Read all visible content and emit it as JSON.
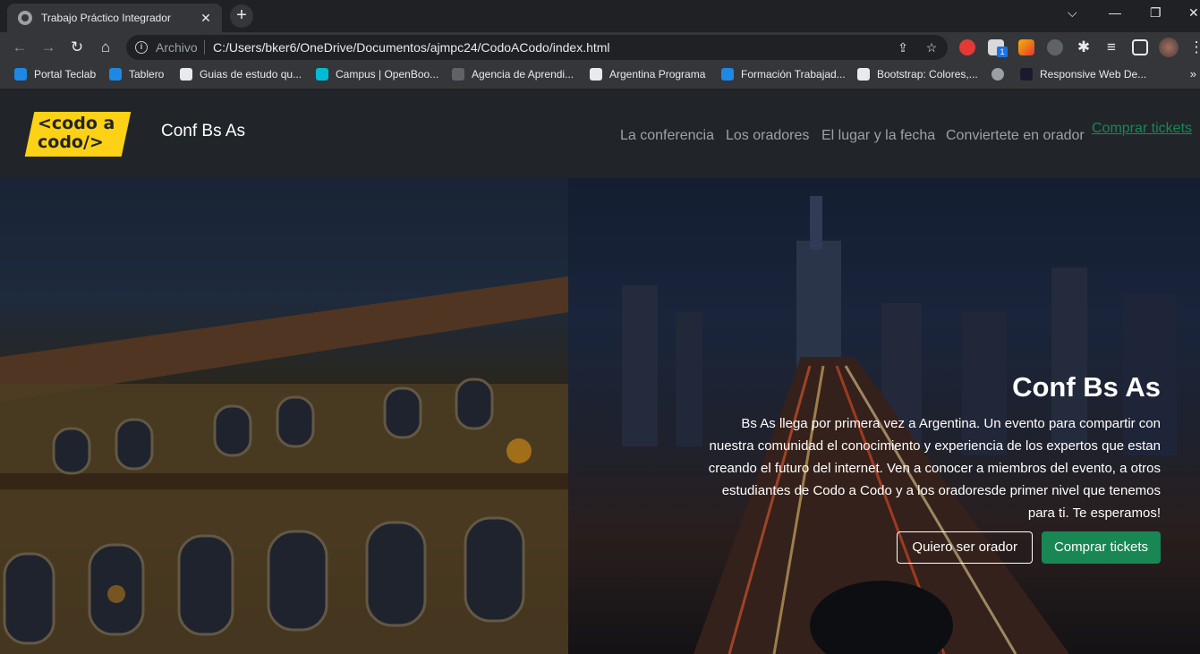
{
  "browser": {
    "tab_title": "Trabajo Práctico Integrador",
    "tab_close": "✕",
    "new_tab": "+",
    "scheme_label": "Archivo",
    "url": "C:/Users/bker6/OneDrive/Documentos/ajmpc24/CodoACodo/index.html",
    "ext_badge": "1",
    "bookmarks": [
      {
        "label": "Portal Teclab",
        "icon_color": "#1e88e5"
      },
      {
        "label": "Tablero",
        "icon_color": "#1e88e5"
      },
      {
        "label": "Guias de estudo qu...",
        "icon_color": "#e8eaed"
      },
      {
        "label": "Campus | OpenBoo...",
        "icon_color": "#00bcd4"
      },
      {
        "label": "Agencia de Aprendi...",
        "icon_color": "#5f6368"
      },
      {
        "label": "Argentina Programa",
        "icon_color": "#e8eaed"
      },
      {
        "label": "Formación Trabajad...",
        "icon_color": "#1e88e5"
      },
      {
        "label": "Bootstrap: Colores,...",
        "icon_color": "#e8eaed"
      },
      {
        "label": "",
        "icon_color": "#9aa0a6"
      },
      {
        "label": "Responsive Web De...",
        "icon_color": "#1a1a2e"
      }
    ],
    "bookmarks_more": "»"
  },
  "site": {
    "logo_line1": "<codo a",
    "logo_line2": "codo/>",
    "brand": "Conf Bs As",
    "menu": [
      "La conferencia",
      "Los oradores",
      "El lugar y la fecha",
      "Conviertete en orador"
    ],
    "menu_cta": "Comprar tickets",
    "hero": {
      "title": "Conf Bs As",
      "text": "Bs As llega por primera vez a Argentina. Un evento para compartir con nuestra comunidad el conocimiento y experiencia de los expertos que estan creando el futuro del internet. Ven a conocer a miembros del evento, a otros estudiantes de Codo a Codo y a los oradoresde primer nivel que tenemos para ti. Te esperamos!",
      "btn_speaker": "Quiero ser orador",
      "btn_tickets": "Comprar tickets"
    }
  },
  "colors": {
    "accent": "#198754",
    "logo_yellow": "#fcd116",
    "navbar_bg": "#212529"
  }
}
